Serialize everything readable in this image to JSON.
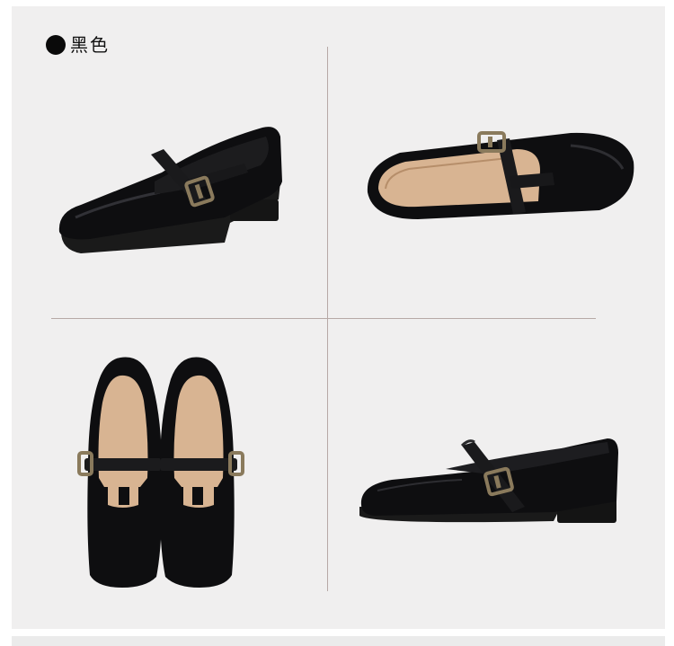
{
  "color_option": {
    "label": "黑色",
    "swatch_color": "#0a0a0a"
  },
  "photos": [
    {
      "name": "shoe-three-quarter-view"
    },
    {
      "name": "shoe-top-side-view"
    },
    {
      "name": "shoe-pair-top-view"
    },
    {
      "name": "shoe-side-profile-view"
    }
  ],
  "colors": {
    "leather": "#0e0e10",
    "insole": "#d8b492",
    "buckle": "#8a7a5c",
    "background": "#f0efef"
  }
}
